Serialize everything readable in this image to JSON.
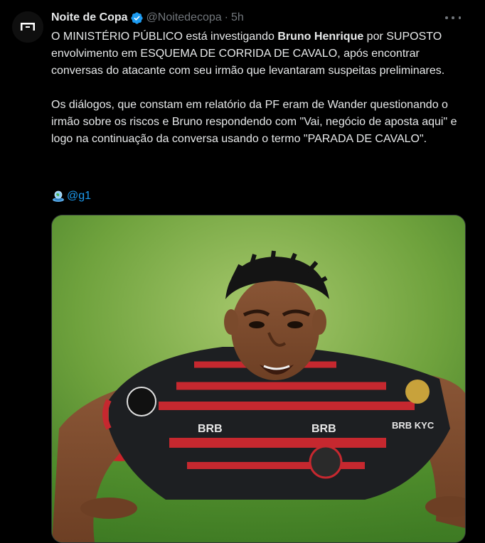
{
  "author": {
    "display_name": "Noite de Copa",
    "handle": "@Noitedecopa",
    "separator": "·",
    "time": "5h",
    "verified": true
  },
  "icons": {
    "avatar": "noite-de-copa-logo-icon",
    "verified": "verified-badge-icon",
    "more": "more-options-icon",
    "globe": "globe-emoji-icon"
  },
  "tweet": {
    "p1_a": "O MINISTÉRIO PÚBLICO está investigando ",
    "p1_bold": "Bruno Henrique",
    "p1_b": " por SUPOSTO envolvimento em ESQUEMA DE CORRIDA DE CAVALO, após encontrar conversas do atacante com seu irmão que levantaram suspeitas preliminares.",
    "p2": "Os diálogos, que constam em relatório da PF eram de Wander questionando o irmão sobre os riscos e Bruno respondendo com \"Vai, negócio de aposta aqui\" e logo na continuação da conversa usando o termo \"PARADA DE CAVALO\".",
    "mention": "@g1"
  },
  "image": {
    "jersey_sponsor": "BRB",
    "sleeve_sponsor": "BRB KYC",
    "collar_text": "BRB"
  },
  "colors": {
    "background": "#000000",
    "text": "#e7e9ea",
    "muted": "#71767b",
    "link": "#1d9bf0",
    "verified": "#1d9bf0",
    "border": "#2f3336"
  }
}
